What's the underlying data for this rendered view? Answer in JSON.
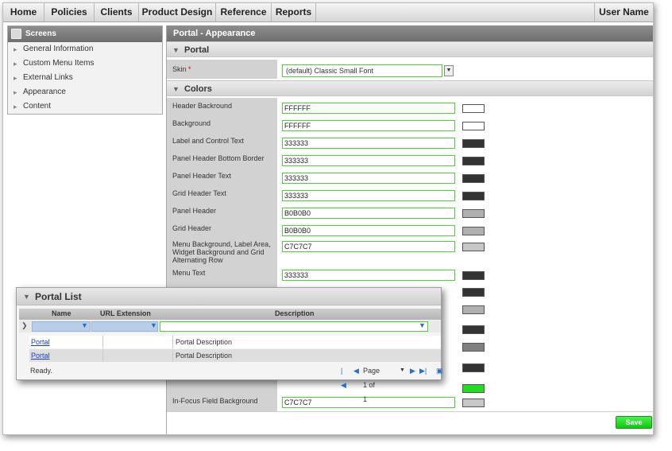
{
  "nav": {
    "items": [
      "Home",
      "Policies",
      "Clients",
      "Product Design",
      "Reference",
      "Reports"
    ],
    "user": "User Name"
  },
  "sidebar": {
    "title": "Screens",
    "items": [
      "General Information",
      "Custom Menu Items",
      "External Links",
      "Appearance",
      "Content"
    ]
  },
  "main": {
    "title": "Portal - Appearance",
    "portal_section": "Portal",
    "skin_label": "Skin",
    "skin_required": "*",
    "skin_value": "(default) Classic Small Font",
    "colors_section": "Colors",
    "save_label": "Save"
  },
  "colors": [
    {
      "label": "Header Backround",
      "value": "FFFFFF",
      "swatch": "#FFFFFF"
    },
    {
      "label": "Background",
      "value": "FFFFFF",
      "swatch": "#FFFFFF"
    },
    {
      "label": "Label and Control Text",
      "value": "333333",
      "swatch": "#333333"
    },
    {
      "label": "Panel Header Bottom Border",
      "value": "333333",
      "swatch": "#333333"
    },
    {
      "label": "Panel Header Text",
      "value": "333333",
      "swatch": "#333333"
    },
    {
      "label": "Grid Header Text",
      "value": "333333",
      "swatch": "#333333"
    },
    {
      "label": "Panel Header",
      "value": "B0B0B0",
      "swatch": "#B0B0B0"
    },
    {
      "label": "Grid Header",
      "value": "B0B0B0",
      "swatch": "#B0B0B0"
    },
    {
      "label": "Menu Background, Label Area, Widget Background and Grid Alternating Row",
      "value": "C7C7C7",
      "swatch": "#C7C7C7"
    },
    {
      "label": "Menu Text",
      "value": "333333",
      "swatch": "#333333"
    }
  ],
  "hidden_swatches": [
    "#333333",
    "#B0B0B0",
    "#333333",
    "#808080",
    "#333333",
    "#22DD22"
  ],
  "focus_row": {
    "label": "In-Focus Field Background",
    "value": "C7C7C7",
    "swatch": "#C7C7C7"
  },
  "portal_list": {
    "title": "Portal List",
    "columns": [
      "Name",
      "URL Extension",
      "Description"
    ],
    "rows": [
      {
        "name": "Portal",
        "url": "",
        "description": "Portal Description"
      },
      {
        "name": "Portal",
        "url": "",
        "description": "Portal Description"
      }
    ],
    "status": "Ready.",
    "page_label": "Page 1 of 1"
  }
}
